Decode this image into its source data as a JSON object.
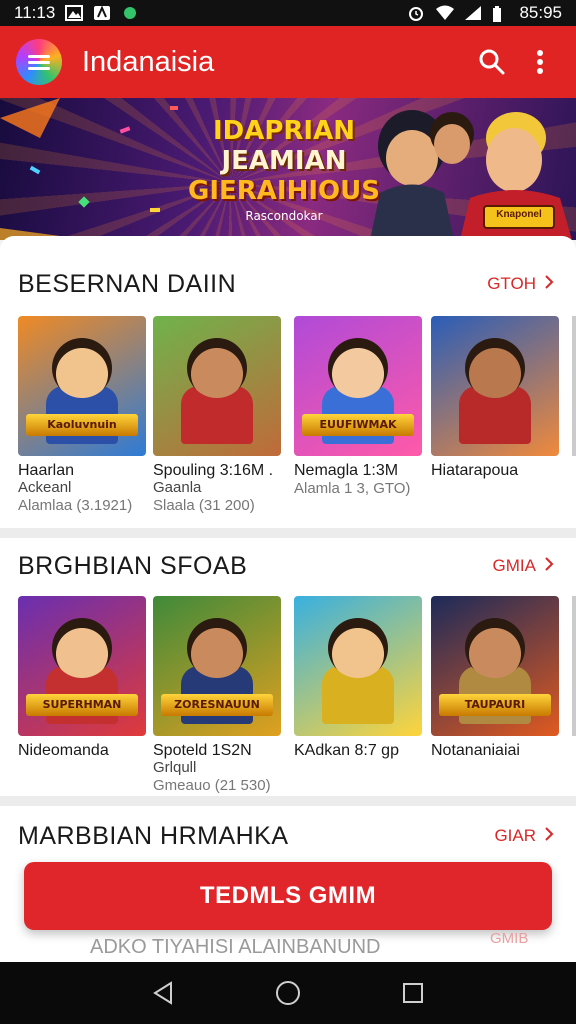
{
  "status_bar": {
    "time": "11:13",
    "clock_right": "85:95"
  },
  "app_bar": {
    "title": "Indanaisia",
    "menu_icon": "menu-icon",
    "search_icon": "search-icon",
    "overflow_icon": "more-vert-icon"
  },
  "banner": {
    "line1": "IDAPRIAN",
    "line2": "JEAMIAN",
    "line3": "GIERAIHIOUS",
    "tagline": "Rascondokar",
    "badge": "Knaponel"
  },
  "sections": [
    {
      "title": "BESERNAN DAIIN",
      "more_label": "GTOH",
      "items": [
        {
          "name": "Haarlan",
          "sub": "Ackeanl",
          "meta": "Alamlaa (3.1921)",
          "art": "Kaoluvnuin",
          "c1": "#f08a24",
          "c2": "#2e7bd6",
          "skin": "#f2c48d",
          "body": "#2c4fa8"
        },
        {
          "name": "Spouling 3:16M .",
          "sub": "Gaanla",
          "meta": "Slaala (31 200)",
          "art": "",
          "c1": "#6fb34c",
          "c2": "#c06a3a",
          "skin": "#c98b5e",
          "body": "#c22b2b"
        },
        {
          "name": "Nemagla 1:3M",
          "sub": "",
          "meta": "Alamla 1 3, GTO)",
          "art": "EUUFIWMAK",
          "c1": "#b04ad8",
          "c2": "#ff5aa8",
          "skin": "#f3c9a0",
          "body": "#3a6fd8"
        },
        {
          "name": "Hiatarapoua",
          "sub": "",
          "meta": "",
          "art": "",
          "c1": "#2a5db8",
          "c2": "#f08a3c",
          "skin": "#b9784e",
          "body": "#b82a2a"
        }
      ]
    },
    {
      "title": "BRGHBIAN SFOAB",
      "more_label": "GMIA",
      "items": [
        {
          "name": "Nideomanda",
          "sub": "",
          "meta": "",
          "art": "SUPERHMAN",
          "c1": "#6a2fb0",
          "c2": "#e03a3a",
          "skin": "#f0c08e",
          "body": "#c43030"
        },
        {
          "name": "Spoteld 1S2N",
          "sub": "Grlqull",
          "meta": "Gmeauo (21 530)",
          "art": "ZORESNAUUN",
          "c1": "#3f8a3a",
          "c2": "#e0a020",
          "skin": "#c98b5e",
          "body": "#263a78"
        },
        {
          "name": "KAdkan 8:7 gp",
          "sub": "",
          "meta": "",
          "art": "",
          "c1": "#38b0e0",
          "c2": "#ffd43b",
          "skin": "#f2c48d",
          "body": "#d8b020"
        },
        {
          "name": "Notananiaiai",
          "sub": "",
          "meta": "",
          "art": "TAUPAURI",
          "c1": "#1c2a5a",
          "c2": "#e05a20",
          "skin": "#c98b5e",
          "body": "#b08a40"
        }
      ]
    },
    {
      "title": "MARBBIAN HRMAHKA",
      "more_label": "GIAR"
    }
  ],
  "cta": {
    "label": "TEDMLS GMIM"
  },
  "under_cta": {
    "text": "ADKO TIYAHISI ALAINBANUND",
    "more": "GMIB"
  },
  "colors": {
    "accent": "#e02424",
    "cta": "#e1262b",
    "more_link": "#d82828"
  },
  "nav_bar": {
    "back_icon": "back-triangle-icon",
    "home_icon": "home-circle-icon",
    "recents_icon": "recents-square-icon"
  }
}
